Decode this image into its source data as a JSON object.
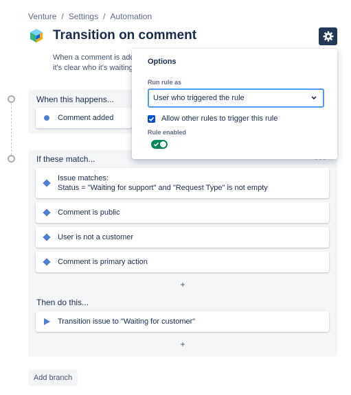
{
  "breadcrumb": [
    "Venture",
    "/",
    "Settings",
    "/",
    "Automation"
  ],
  "page": {
    "title": "Transition on comment",
    "description_line1": "When a comment is added",
    "description_line2": "it's clear who it's waiting on"
  },
  "trigger_section": {
    "label": "When this happens...",
    "trigger": "Comment added"
  },
  "conditions_section": {
    "label": "If these match...",
    "more": "•••",
    "items": [
      {
        "line1": "Issue matches:",
        "line2": "Status = \"Waiting for support\" and \"Request Type\" is not empty"
      },
      {
        "line1": "Comment is public"
      },
      {
        "line1": "User is not a customer"
      },
      {
        "line1": "Comment is primary action"
      }
    ],
    "add": "+"
  },
  "actions_section": {
    "label": "Then do this...",
    "items": [
      {
        "line1": "Transition issue to \"Waiting for customer\""
      }
    ],
    "add": "+"
  },
  "add_branch_label": "Add branch",
  "options_panel": {
    "title": "Options",
    "run_rule_as_label": "Run rule as",
    "run_rule_as_value": "User who triggered the rule",
    "allow_other_rules_label": "Allow other rules to trigger this rule",
    "allow_other_rules_checked": true,
    "rule_enabled_label": "Rule enabled",
    "rule_enabled": true
  },
  "colors": {
    "accent": "#0052cc",
    "gear_button": "#253858",
    "toggle_on": "#00875a",
    "icon_blue": "#4c7fd6",
    "section_bg": "#f4f5f7"
  }
}
